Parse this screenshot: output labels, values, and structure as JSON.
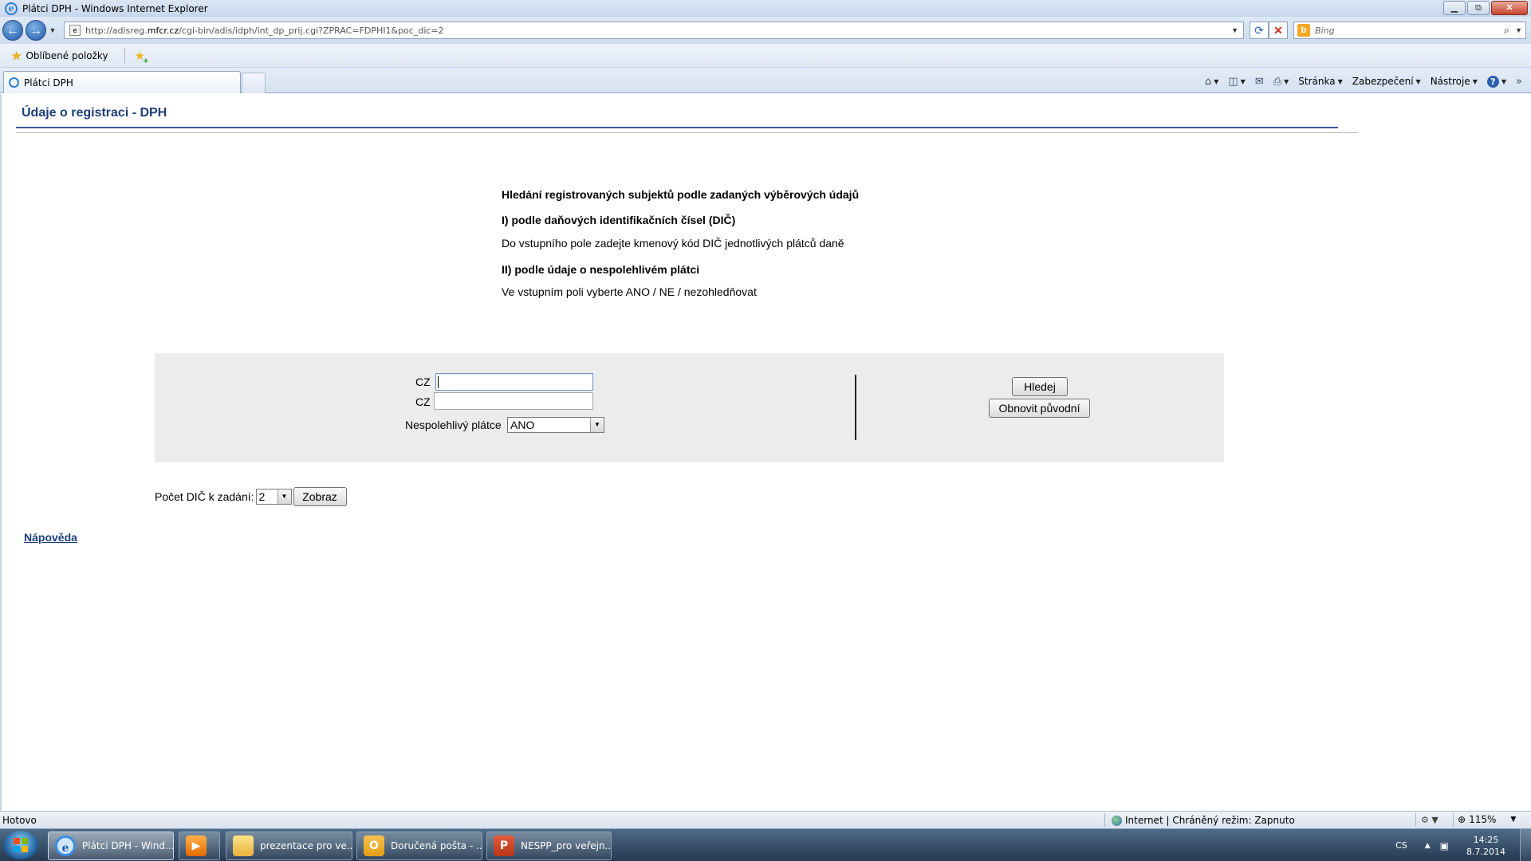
{
  "window": {
    "title": "Plátci DPH - Windows Internet Explorer",
    "minimize": "▭",
    "restore": "⧉",
    "close": "✕"
  },
  "addressbar": {
    "url_prefix": "http://adisreg.",
    "url_domain": "mfcr.cz",
    "url_path": "/cgi-bin/adis/idph/int_dp_prij.cgi?ZPRAC=FDPHI1&poc_dic=2",
    "search_placeholder": "Bing"
  },
  "favorites": {
    "label": "Oblíbené položky"
  },
  "tabs": {
    "active_label": "Plátci DPH"
  },
  "commandbar": {
    "page": "Stránka",
    "security": "Zabezpečení",
    "tools": "Nástroje",
    "help": "?"
  },
  "page": {
    "heading": "Údaje o registraci - DPH",
    "intro": {
      "title": "Hledání registrovaných subjektů podle zadaných výběrových údajů",
      "section1_title": "I) podle daňových identifikačních čísel (DIČ)",
      "section1_text": "Do vstupního pole zadejte kmenový kód DIČ jednotlivých plátců daně",
      "section2_title": "II) podle údaje o nespolehlivém plátci",
      "section2_text": "Ve vstupním poli vyberte ANO / NE / nezohledňovat"
    },
    "form": {
      "dic_prefix_1": "CZ",
      "dic_prefix_2": "CZ",
      "dic_value_1": "",
      "dic_value_2": "",
      "unreliable_label": "Nespolehlivý plátce",
      "unreliable_value": "ANO",
      "search_button": "Hledej",
      "reset_button": "Obnovit původní"
    },
    "count": {
      "label": "Počet DIČ k zadání:",
      "value": "2",
      "show_button": "Zobraz"
    },
    "help_link": "Nápověda"
  },
  "statusbar": {
    "status": "Hotovo",
    "zone": "Internet | Chráněný režim: Zapnuto",
    "zoom": "115%"
  },
  "taskbar": {
    "items": [
      {
        "label": "Plátci DPH - Wind..."
      },
      {
        "label": ""
      },
      {
        "label": "prezentace pro ve..."
      },
      {
        "label": "Doručená pošta - ..."
      },
      {
        "label": "NESPP_pro veřejn..."
      }
    ],
    "language": "CS",
    "time": "14:25",
    "date": "8.7.2014"
  }
}
